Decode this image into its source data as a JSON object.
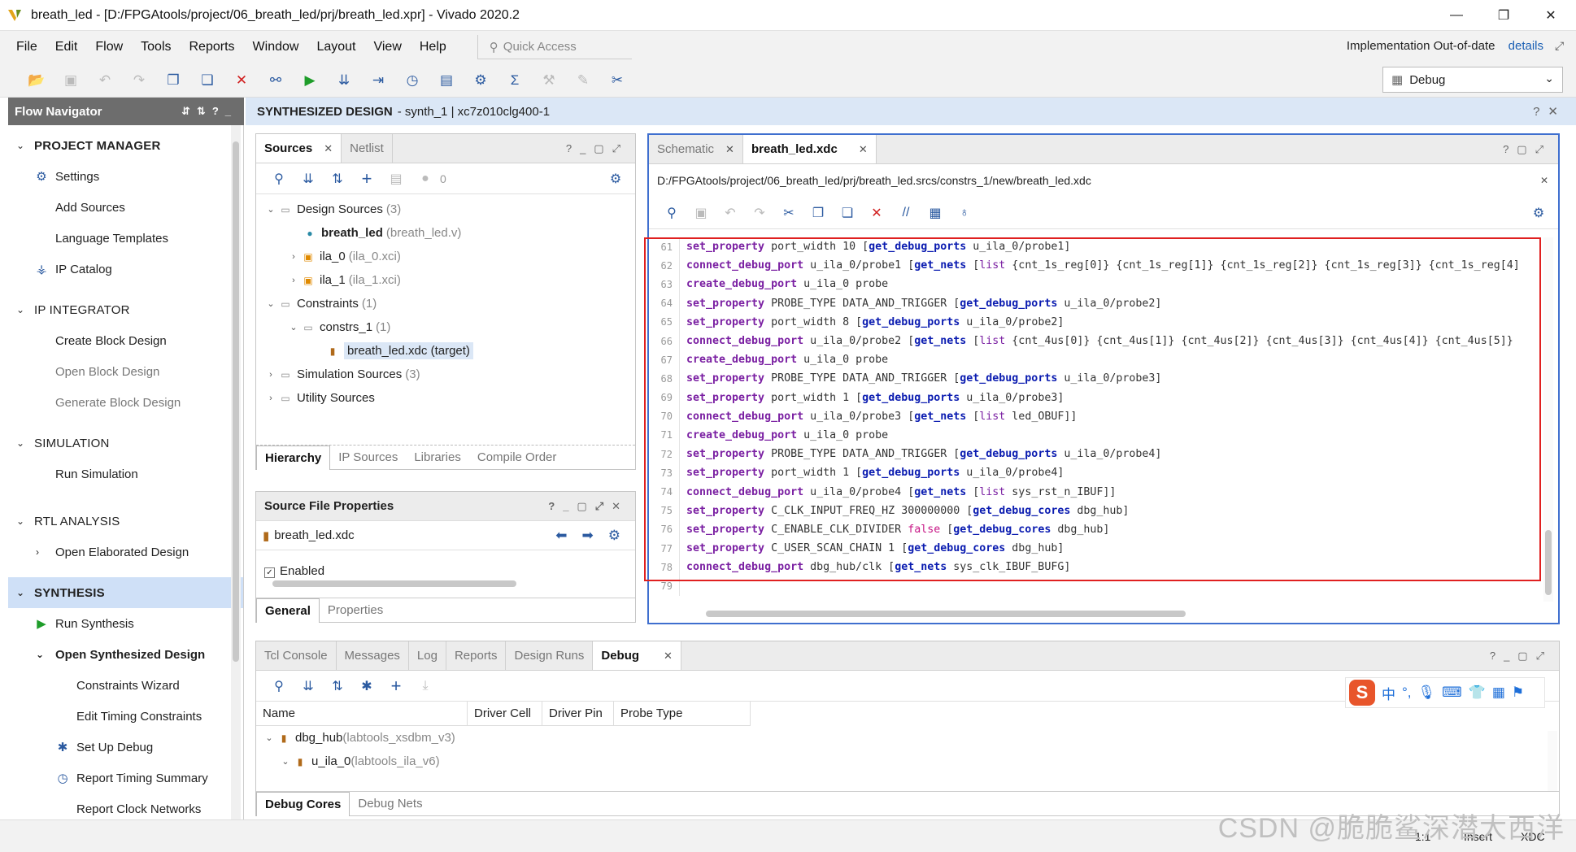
{
  "window": {
    "title": "breath_led - [D:/FPGAtools/project/06_breath_led/prj/breath_led.xpr] - Vivado 2020.2"
  },
  "menu": [
    "File",
    "Edit",
    "Flow",
    "Tools",
    "Reports",
    "Window",
    "Layout",
    "View",
    "Help"
  ],
  "quick_access": "Quick Access",
  "status": {
    "impl": "Implementation Out-of-date",
    "details": "details"
  },
  "layout_select": "Debug",
  "flow_nav": {
    "title": "Flow Navigator",
    "sections": [
      {
        "name": "PROJECT MANAGER",
        "items": [
          "Settings",
          "Add Sources",
          "Language Templates",
          "IP Catalog"
        ]
      },
      {
        "name": "IP INTEGRATOR",
        "items": [
          "Create Block Design",
          "Open Block Design",
          "Generate Block Design"
        ]
      },
      {
        "name": "SIMULATION",
        "items": [
          "Run Simulation"
        ]
      },
      {
        "name": "RTL ANALYSIS",
        "items": [
          "Open Elaborated Design"
        ]
      },
      {
        "name": "SYNTHESIS",
        "items": [
          "Run Synthesis",
          "Open Synthesized Design",
          "Constraints Wizard",
          "Edit Timing Constraints",
          "Set Up Debug",
          "Report Timing Summary",
          "Report Clock Networks"
        ]
      }
    ]
  },
  "synth_header": {
    "title": "SYNTHESIZED DESIGN",
    "detail": "- synth_1 | xc7z010clg400-1"
  },
  "sources": {
    "tabs": [
      "Sources",
      "Netlist"
    ],
    "count": "0",
    "tree": [
      {
        "label": "Design Sources",
        "extra": "(3)"
      },
      {
        "label": "breath_led",
        "extra": "(breath_led.v)"
      },
      {
        "label": "ila_0",
        "extra": "(ila_0.xci)"
      },
      {
        "label": "ila_1",
        "extra": "(ila_1.xci)"
      },
      {
        "label": "Constraints",
        "extra": "(1)"
      },
      {
        "label": "constrs_1",
        "extra": "(1)"
      },
      {
        "label": "breath_led.xdc (target)",
        "extra": ""
      },
      {
        "label": "Simulation Sources",
        "extra": "(3)"
      },
      {
        "label": "Utility Sources",
        "extra": ""
      }
    ],
    "subtabs": [
      "Hierarchy",
      "IP Sources",
      "Libraries",
      "Compile Order"
    ]
  },
  "props": {
    "title": "Source File Properties",
    "file": "breath_led.xdc",
    "enabled": "Enabled",
    "subtabs": [
      "General",
      "Properties"
    ]
  },
  "editor": {
    "tabs": [
      "Schematic",
      "breath_led.xdc"
    ],
    "path": "D:/FPGAtools/project/06_breath_led/prj/breath_led.srcs/constrs_1/new/breath_led.xdc",
    "lines": [
      {
        "n": "61",
        "t": [
          [
            "kw",
            "set_property"
          ],
          [
            "tx",
            " port_width 10 ["
          ],
          [
            "kw2",
            "get_debug_ports"
          ],
          [
            "tx",
            " u_ila_0/probe1]"
          ]
        ]
      },
      {
        "n": "62",
        "t": [
          [
            "kw",
            "connect_debug_port"
          ],
          [
            "tx",
            " u_ila_0/probe1 ["
          ],
          [
            "kw2",
            "get_nets"
          ],
          [
            "tx",
            " ["
          ],
          [
            "bl",
            "list"
          ],
          [
            "tx",
            " {cnt_1s_reg[0]} {cnt_1s_reg[1]} {cnt_1s_reg[2]} {cnt_1s_reg[3]} {cnt_1s_reg[4]"
          ]
        ]
      },
      {
        "n": "63",
        "t": [
          [
            "kw",
            "create_debug_port"
          ],
          [
            "tx",
            " u_ila_0 probe"
          ]
        ]
      },
      {
        "n": "64",
        "t": [
          [
            "kw",
            "set_property"
          ],
          [
            "tx",
            " PROBE_TYPE DATA_AND_TRIGGER ["
          ],
          [
            "kw2",
            "get_debug_ports"
          ],
          [
            "tx",
            " u_ila_0/probe2]"
          ]
        ]
      },
      {
        "n": "65",
        "t": [
          [
            "kw",
            "set_property"
          ],
          [
            "tx",
            " port_width 8 ["
          ],
          [
            "kw2",
            "get_debug_ports"
          ],
          [
            "tx",
            " u_ila_0/probe2]"
          ]
        ]
      },
      {
        "n": "66",
        "t": [
          [
            "kw",
            "connect_debug_port"
          ],
          [
            "tx",
            " u_ila_0/probe2 ["
          ],
          [
            "kw2",
            "get_nets"
          ],
          [
            "tx",
            " ["
          ],
          [
            "bl",
            "list"
          ],
          [
            "tx",
            " {cnt_4us[0]} {cnt_4us[1]} {cnt_4us[2]} {cnt_4us[3]} {cnt_4us[4]} {cnt_4us[5]}"
          ]
        ]
      },
      {
        "n": "67",
        "t": [
          [
            "kw",
            "create_debug_port"
          ],
          [
            "tx",
            " u_ila_0 probe"
          ]
        ]
      },
      {
        "n": "68",
        "t": [
          [
            "kw",
            "set_property"
          ],
          [
            "tx",
            " PROBE_TYPE DATA_AND_TRIGGER ["
          ],
          [
            "kw2",
            "get_debug_ports"
          ],
          [
            "tx",
            " u_ila_0/probe3]"
          ]
        ]
      },
      {
        "n": "69",
        "t": [
          [
            "kw",
            "set_property"
          ],
          [
            "tx",
            " port_width 1 ["
          ],
          [
            "kw2",
            "get_debug_ports"
          ],
          [
            "tx",
            " u_ila_0/probe3]"
          ]
        ]
      },
      {
        "n": "70",
        "t": [
          [
            "kw",
            "connect_debug_port"
          ],
          [
            "tx",
            " u_ila_0/probe3 ["
          ],
          [
            "kw2",
            "get_nets"
          ],
          [
            "tx",
            " ["
          ],
          [
            "bl",
            "list"
          ],
          [
            "tx",
            " led_OBUF]]"
          ]
        ]
      },
      {
        "n": "71",
        "t": [
          [
            "kw",
            "create_debug_port"
          ],
          [
            "tx",
            " u_ila_0 probe"
          ]
        ]
      },
      {
        "n": "72",
        "t": [
          [
            "kw",
            "set_property"
          ],
          [
            "tx",
            " PROBE_TYPE DATA_AND_TRIGGER ["
          ],
          [
            "kw2",
            "get_debug_ports"
          ],
          [
            "tx",
            " u_ila_0/probe4]"
          ]
        ]
      },
      {
        "n": "73",
        "t": [
          [
            "kw",
            "set_property"
          ],
          [
            "tx",
            " port_width 1 ["
          ],
          [
            "kw2",
            "get_debug_ports"
          ],
          [
            "tx",
            " u_ila_0/probe4]"
          ]
        ]
      },
      {
        "n": "74",
        "t": [
          [
            "kw",
            "connect_debug_port"
          ],
          [
            "tx",
            " u_ila_0/probe4 ["
          ],
          [
            "kw2",
            "get_nets"
          ],
          [
            "tx",
            " ["
          ],
          [
            "bl",
            "list"
          ],
          [
            "tx",
            " sys_rst_n_IBUF]]"
          ]
        ]
      },
      {
        "n": "75",
        "t": [
          [
            "kw",
            "set_property"
          ],
          [
            "tx",
            " C_CLK_INPUT_FREQ_HZ 300000000 ["
          ],
          [
            "kw2",
            "get_debug_cores"
          ],
          [
            "tx",
            " dbg_hub]"
          ]
        ]
      },
      {
        "n": "76",
        "t": [
          [
            "kw",
            "set_property"
          ],
          [
            "tx",
            " C_ENABLE_CLK_DIVIDER "
          ],
          [
            "fa",
            "false"
          ],
          [
            "tx",
            " ["
          ],
          [
            "kw2",
            "get_debug_cores"
          ],
          [
            "tx",
            " dbg_hub]"
          ]
        ]
      },
      {
        "n": "77",
        "t": [
          [
            "kw",
            "set_property"
          ],
          [
            "tx",
            " C_USER_SCAN_CHAIN 1 ["
          ],
          [
            "kw2",
            "get_debug_cores"
          ],
          [
            "tx",
            " dbg_hub]"
          ]
        ]
      },
      {
        "n": "78",
        "t": [
          [
            "kw",
            "connect_debug_port"
          ],
          [
            "tx",
            " dbg_hub/clk ["
          ],
          [
            "kw2",
            "get_nets"
          ],
          [
            "tx",
            " sys_clk_IBUF_BUFG]"
          ]
        ]
      },
      {
        "n": "79",
        "t": []
      }
    ]
  },
  "bottom": {
    "tabs": [
      "Tcl Console",
      "Messages",
      "Log",
      "Reports",
      "Design Runs",
      "Debug"
    ],
    "columns": [
      "Name",
      "Driver Cell",
      "Driver Pin",
      "Probe Type"
    ],
    "rows": [
      {
        "name": "dbg_hub",
        "type": "(labtools_xsdbm_v3)"
      },
      {
        "name": "u_ila_0",
        "type": "(labtools_ila_v6)"
      }
    ],
    "subtabs": [
      "Debug Cores",
      "Debug Nets"
    ]
  },
  "statusbar": {
    "pos": "1:1",
    "mode": "Insert",
    "lang": "XDC"
  },
  "watermark": "CSDN @脆脆鲨深潜大西洋",
  "ime": {
    "zh": "中"
  }
}
